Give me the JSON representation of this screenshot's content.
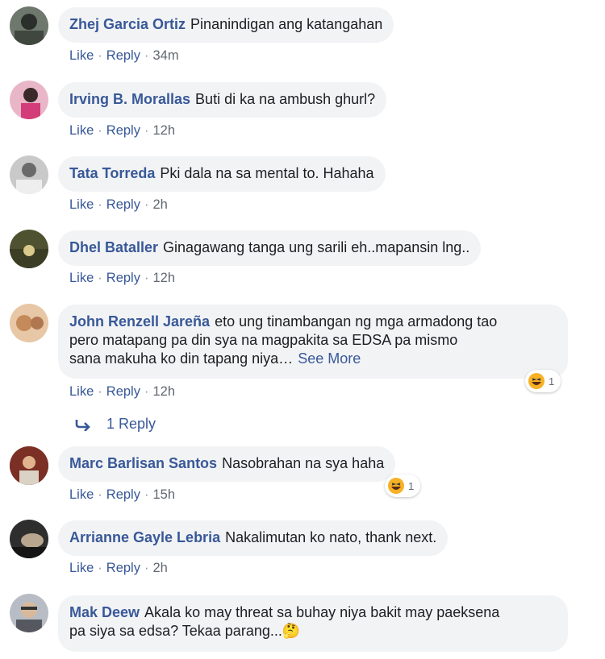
{
  "comments": [
    {
      "author": "Zhej Garcia Ortiz",
      "text": "Pinanindigan ang katangahan",
      "time": "34m",
      "avatar_color": "#5c6a5c"
    },
    {
      "author": "Irving B. Morallas",
      "text": "Buti di ka na ambush ghurl?",
      "time": "12h",
      "avatar_color": "#d96f9a"
    },
    {
      "author": "Tata Torreda",
      "text": "Pki dala na sa mental to. Hahaha",
      "time": "2h",
      "avatar_color": "#9a9a9a"
    },
    {
      "author": "Dhel Bataller",
      "text": "Ginagawang tanga ung sarili eh..mapansin lng..",
      "time": "12h",
      "avatar_color": "#6b6c3a"
    },
    {
      "author": "John Renzell Jareña",
      "text_lines": [
        "eto ung tinambangan ng mga armadong tao",
        "pero matapang pa din sya na magpakita sa EDSA pa mismo",
        "sana makuha ko din tapang niya…"
      ],
      "see_more": "See More",
      "time": "12h",
      "reaction_count": "1",
      "avatar_color": "#c08a5c"
    },
    {
      "author": "Marc Barlisan Santos",
      "text": "Nasobrahan na sya haha",
      "time": "15h",
      "reaction_count": "1",
      "avatar_color": "#9b4a3a"
    },
    {
      "author": "Arrianne Gayle Lebria",
      "text": "Nakalimutan ko nato, thank next.",
      "time": "2h",
      "avatar_color": "#3a3a3a"
    },
    {
      "author": "Mak Deew",
      "text_lines": [
        "Akala ko may threat sa buhay niya bakit may paeksena",
        "pa siya sa edsa? Tekaa parang...🤔"
      ],
      "avatar_color": "#8d8f96"
    }
  ],
  "actions": {
    "like": "Like",
    "reply": "Reply",
    "separator": "·"
  },
  "replies_link": "1 Reply",
  "colors": {
    "link": "#385898",
    "bubble": "#f2f3f5",
    "meta": "#616770"
  }
}
